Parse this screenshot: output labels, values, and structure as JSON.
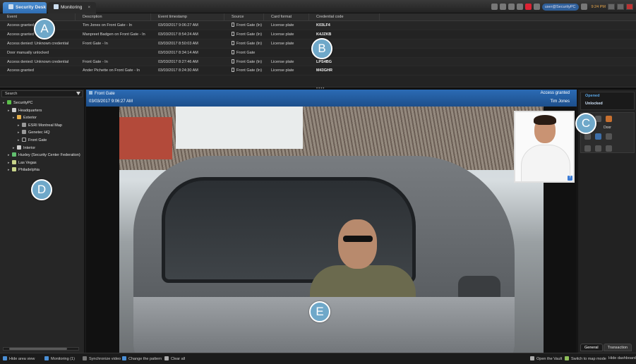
{
  "tabs": [
    {
      "label": "Security Desk"
    },
    {
      "label": "Monitoring"
    }
  ],
  "tray": {
    "user": "user@SecurityPC",
    "time": "9:24 PM"
  },
  "events": {
    "columns": [
      "Event",
      "Description",
      "Event timestamp",
      "Source",
      "Card format",
      "Credential code"
    ],
    "rows": [
      [
        "Access granted",
        "Tim Jones on Front Gate - In",
        "03/03/2017 9:06:27 AM",
        "Front Gate (In)",
        "License plate",
        "K03LF4"
      ],
      [
        "Access granted",
        "Manpreet Badgen on Front Gate - In",
        "03/03/2017 8:54:24 AM",
        "Front Gate (In)",
        "License plate",
        "K4JZKB"
      ],
      [
        "Access denied: Unknown credential",
        "Front Gate - In",
        "03/03/2017 8:50:03 AM",
        "Front Gate (In)",
        "License plate",
        "HF64L8"
      ],
      [
        "Door manually unlocked",
        "",
        "03/03/2017 8:34:14 AM",
        "Front Gate",
        "",
        ""
      ],
      [
        "Access denied: Unknown credential",
        "Front Gate - In",
        "03/03/2017 8:27:46 AM",
        "Front Gate (In)",
        "License plate",
        "LPS4BG"
      ],
      [
        "Access granted",
        "Ander Pichette on Front Gate - In",
        "03/03/2017 8:24:30 AM",
        "Front Gate (In)",
        "License plate",
        "M43GHR"
      ]
    ]
  },
  "left": {
    "search_placeholder": "Search",
    "tree": [
      {
        "label": "SecurityPC",
        "level": 0,
        "icon": "network-icon"
      },
      {
        "label": "Headquarters",
        "level": 1,
        "icon": "area-icon"
      },
      {
        "label": "Exterior",
        "level": 2,
        "icon": "exterior-icon"
      },
      {
        "label": "ESRI Montreal Map",
        "level": 3,
        "icon": "map-icon"
      },
      {
        "label": "Genetec HQ",
        "level": 3,
        "icon": "map-icon"
      },
      {
        "label": "Front Gate",
        "level": 3,
        "icon": "door-icon"
      },
      {
        "label": "Interior",
        "level": 2,
        "icon": "area-icon"
      },
      {
        "label": "Huxley (Security Center Federation)",
        "level": 1,
        "icon": "federation-icon"
      },
      {
        "label": "Las Vegas",
        "level": 1,
        "icon": "folder-icon"
      },
      {
        "label": "Philadelphia",
        "level": 1,
        "icon": "folder-icon"
      }
    ]
  },
  "tile": {
    "source": "Front Gate",
    "timestamp": "03/03/2017 9:06:27 AM",
    "event": "Access granted",
    "cardholder": "Tim Jones",
    "pip_badge": "?"
  },
  "right": {
    "status_open": "Opened",
    "status_unlocked": "Unlocked",
    "door_label": "Door",
    "tabs": [
      "General",
      "Transaction"
    ]
  },
  "bottom": {
    "hide_area_view": "Hide area view",
    "monitoring": "Monitoring (1)",
    "sync_video": "Synchronize video",
    "change_pattern": "Change the pattern",
    "clear_all": "Clear all",
    "open_vault": "Open the Vault",
    "map_mode": "Switch to map mode",
    "hide_dashboard": "Hide dashboard"
  },
  "callouts": [
    "A",
    "B",
    "C",
    "D",
    "E"
  ]
}
